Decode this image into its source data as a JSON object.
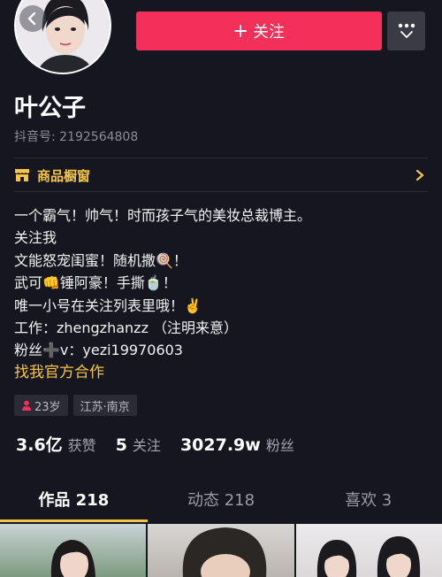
{
  "header": {
    "follow_label": "关注",
    "follow_icon": "plus-icon",
    "more_icon": "more-dots-icon"
  },
  "profile": {
    "name": "叶公子",
    "douyin_id": "抖音号: 2192564808"
  },
  "shop": {
    "label": "商品橱窗",
    "icon": "shop-icon"
  },
  "bio": {
    "line1": "一个霸气！帅气！时而孩子气的美妆总裁博主。",
    "line2": "关注我",
    "line3": "文能怒宠闺蜜！随机撒🍭！",
    "line4": "武可👊锤阿豪！手撕🍵！",
    "line5": "唯一小号在关注列表里哦！✌️",
    "line6": "工作：zhengzhanzz （注明来意）",
    "line7": "粉丝➕v：yezi19970603",
    "link": "找我官方合作"
  },
  "tags": {
    "age": "23岁",
    "location": "江苏·南京"
  },
  "stats": {
    "likes_value": "3.6亿",
    "likes_label": "获赞",
    "following_value": "5",
    "following_label": "关注",
    "followers_value": "3027.9w",
    "followers_label": "粉丝"
  },
  "tabs": {
    "works": "作品 218",
    "dynamics": "动态 218",
    "likes": "喜欢 3"
  },
  "colors": {
    "accent_red": "#f2305a",
    "accent_yellow": "#f6c545",
    "background": "#15161f"
  }
}
